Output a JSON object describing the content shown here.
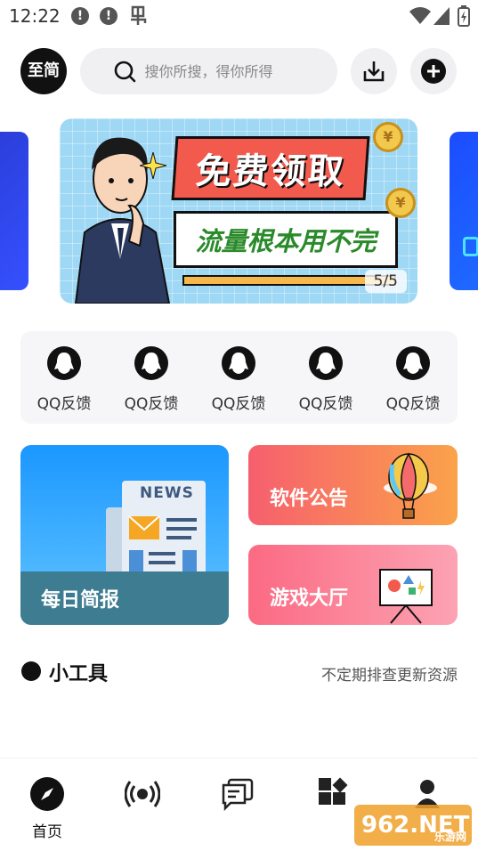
{
  "status_bar": {
    "time": "12:22"
  },
  "header": {
    "avatar_label": "至简",
    "search_placeholder": "搜你所搜，得你所得"
  },
  "banner": {
    "headline": "免费领取",
    "subline": "流量根本用不完",
    "counter": "5/5",
    "coin_symbol": "¥"
  },
  "feedback_items": [
    {
      "label": "QQ反馈"
    },
    {
      "label": "QQ反馈"
    },
    {
      "label": "QQ反馈"
    },
    {
      "label": "QQ反馈"
    },
    {
      "label": "QQ反馈"
    }
  ],
  "cards": {
    "daily": {
      "title": "每日简报",
      "news_label": "NEWS"
    },
    "notice": {
      "title": "软件公告"
    },
    "games": {
      "title": "游戏大厅"
    }
  },
  "tools": {
    "title": "小工具",
    "subtitle": "不定期排查更新资源"
  },
  "bottom_nav": [
    {
      "label": "首页",
      "icon": "compass-icon"
    },
    {
      "label": "",
      "icon": "broadcast-icon"
    },
    {
      "label": "",
      "icon": "chat-icon"
    },
    {
      "label": "",
      "icon": "apps-icon"
    },
    {
      "label": "",
      "icon": "user-icon"
    }
  ],
  "watermark": {
    "text": "962.NET",
    "sub": "乐游网"
  },
  "colors": {
    "accent": "#111111",
    "notice_gradient": [
      "#f65f6e",
      "#fba24a"
    ],
    "games_gradient": [
      "#fb6a83",
      "#fca3b3"
    ],
    "daily_gradient": [
      "#1b97ff",
      "#63c5ff"
    ]
  }
}
